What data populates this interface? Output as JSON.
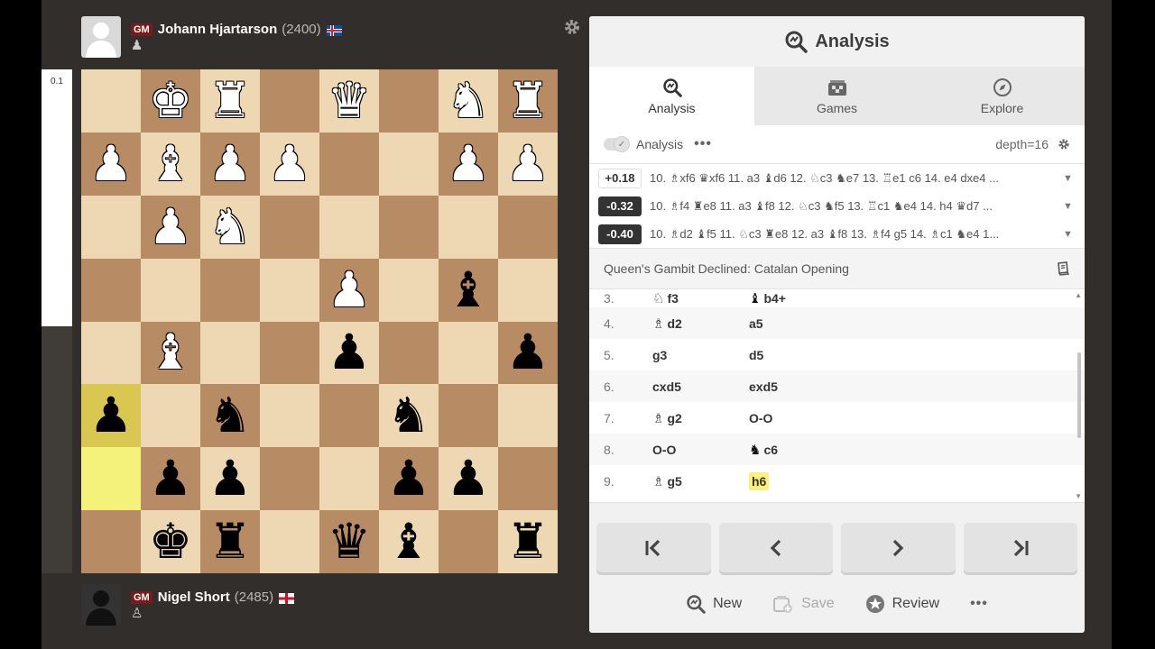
{
  "top_player": {
    "title": "GM",
    "name": "Johann Hjartarson",
    "rating": "(2400)",
    "flag": "iceland",
    "piece": "♟"
  },
  "bottom_player": {
    "title": "GM",
    "name": "Nigel Short",
    "rating": "(2485)",
    "flag": "england",
    "piece": "♙"
  },
  "eval_bar": {
    "label": "0.1",
    "white_share": 0.51
  },
  "board": [
    [
      "",
      "K",
      "R",
      "",
      "Q",
      "",
      "N",
      "R"
    ],
    [
      "P",
      "B",
      "P",
      "P",
      "",
      "",
      "P",
      "P"
    ],
    [
      "",
      "P",
      "N",
      "",
      "",
      "",
      "",
      ""
    ],
    [
      "",
      "",
      "",
      "",
      "P",
      "",
      "b",
      ""
    ],
    [
      "",
      "B",
      "",
      "",
      "p",
      "",
      "",
      "p"
    ],
    [
      "p",
      "",
      "n",
      "",
      "",
      "n",
      "",
      ""
    ],
    [
      "",
      "p",
      "p",
      "",
      "",
      "p",
      "p",
      ""
    ],
    [
      "",
      "k",
      "r",
      "",
      "q",
      "b",
      "",
      "r"
    ]
  ],
  "panel": {
    "title": "Analysis",
    "tabs": [
      {
        "label": "Analysis",
        "icon": "analysis-icon"
      },
      {
        "label": "Games",
        "icon": "games-icon"
      },
      {
        "label": "Explore",
        "icon": "compass-icon"
      }
    ],
    "engine_label": "Analysis",
    "engine_dots": "•••",
    "depth": "depth=16",
    "lines": [
      {
        "score": "+0.18",
        "sign": "pos",
        "text": "10. ♗xf6 ♛xf6 11. a3 ♝d6 12. ♘c3 ♞e7 13. ♖e1 c6 14. e4 dxe4 ..."
      },
      {
        "score": "-0.32",
        "sign": "neg",
        "text": "10. ♗f4 ♜e8 11. a3 ♝f8 12. ♘c3 ♞f5 13. ♖c1 ♞e4 14. h4 ♛d7 ..."
      },
      {
        "score": "-0.40",
        "sign": "neg",
        "text": "10. ♗d2 ♝f5 11. ♘c3 ♜e8 12. a3 ♝f8 13. ♗f4 g5 14. ♗c1 ♞e4 1..."
      }
    ],
    "opening": "Queen's Gambit Declined: Catalan Opening",
    "moves": [
      {
        "num": "3.",
        "wfig": "♘",
        "w": "f3",
        "bfig": "♝",
        "b": "b4+"
      },
      {
        "num": "4.",
        "wfig": "♗",
        "w": "d2",
        "bfig": "",
        "b": "a5"
      },
      {
        "num": "5.",
        "wfig": "",
        "w": "g3",
        "bfig": "",
        "b": "d5"
      },
      {
        "num": "6.",
        "wfig": "",
        "w": "cxd5",
        "bfig": "",
        "b": "exd5"
      },
      {
        "num": "7.",
        "wfig": "♗",
        "w": "g2",
        "bfig": "",
        "b": "O-O"
      },
      {
        "num": "8.",
        "wfig": "",
        "w": "O-O",
        "bfig": "♞",
        "b": "c6"
      },
      {
        "num": "9.",
        "wfig": "♗",
        "w": "g5",
        "bfig": "",
        "b": "h6"
      }
    ],
    "actions": {
      "new": "New",
      "save": "Save",
      "review": "Review",
      "more": "•••"
    }
  }
}
